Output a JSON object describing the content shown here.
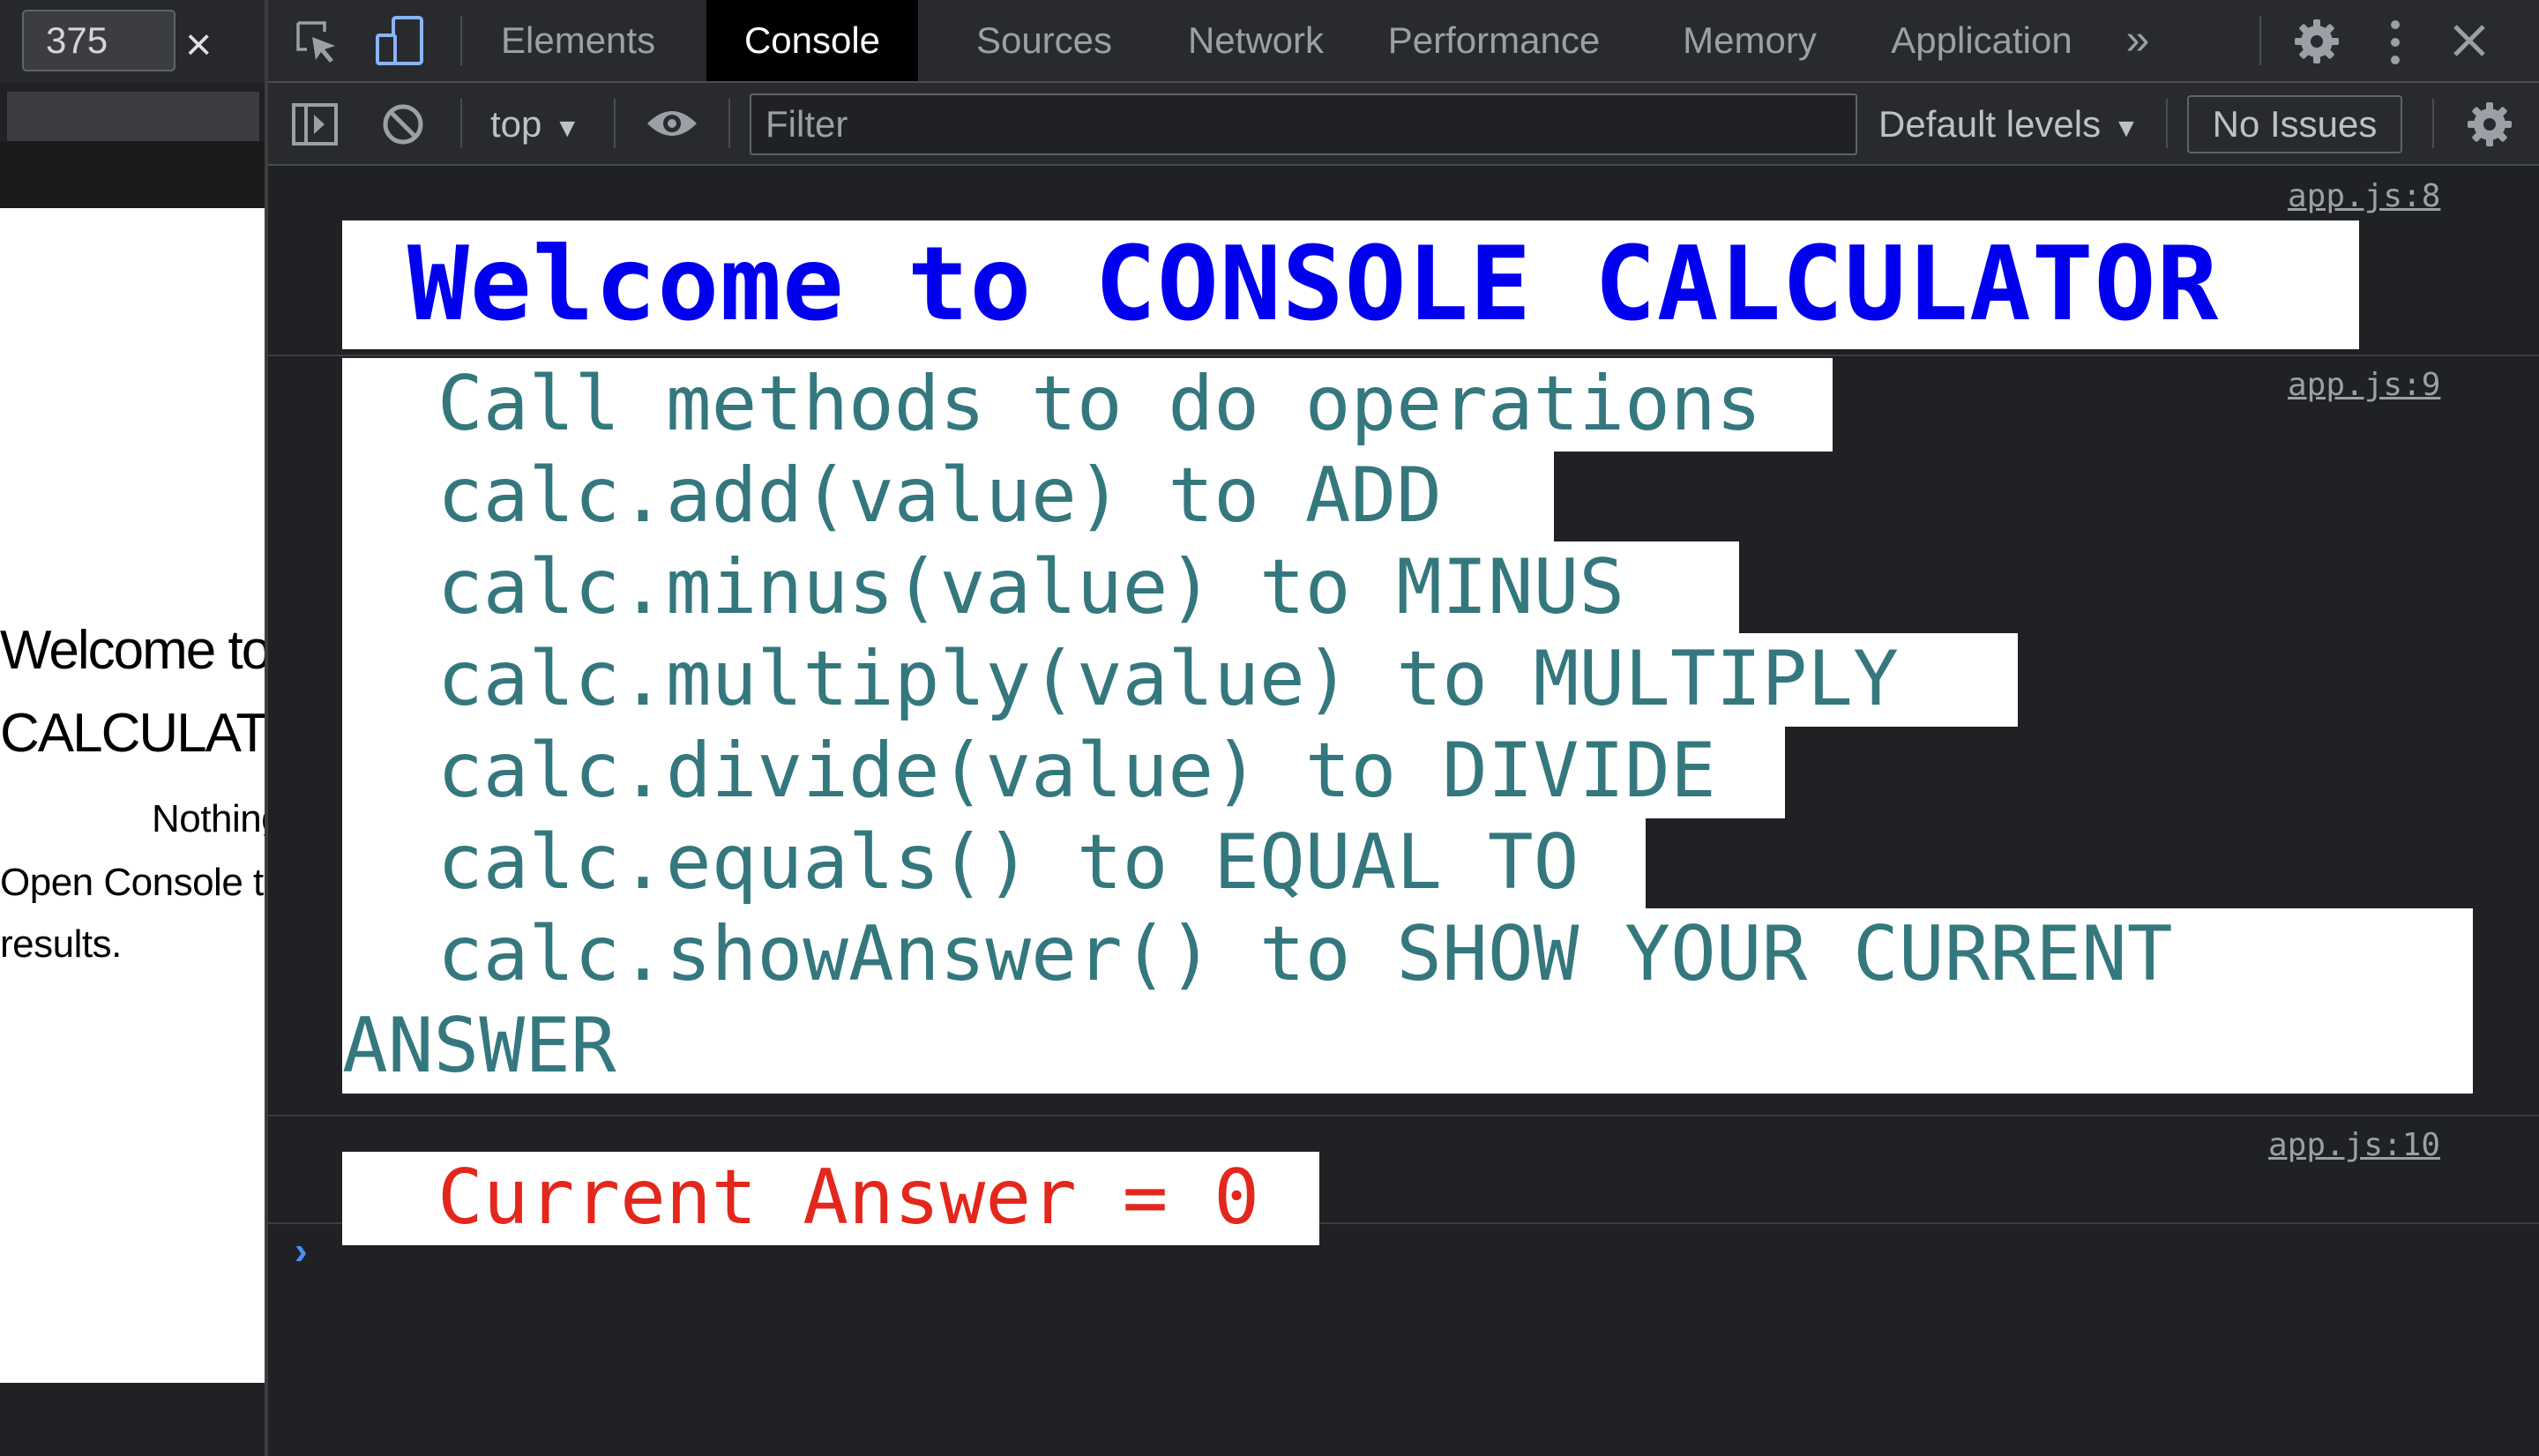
{
  "device_toolbar": {
    "width_value": "375",
    "close_glyph": "×"
  },
  "page_preview": {
    "heading_line1": "Welcome to CONSOLE",
    "heading_line2": "CALCULATOR",
    "paragraph_line1": "Nothing to see here.",
    "paragraph_line2": "Open Console to see",
    "paragraph_line3": "results."
  },
  "devtools": {
    "tabs": [
      "Elements",
      "Console",
      "Sources",
      "Network",
      "Performance",
      "Memory",
      "Application"
    ],
    "active_tab": "Console",
    "more_tabs_glyph": "»",
    "toolbar": {
      "context": "top",
      "filter_placeholder": "Filter",
      "levels": "Default levels",
      "issues": "No Issues"
    }
  },
  "console": {
    "messages": [
      {
        "source": "app.js:8",
        "text": "Welcome to CONSOLE CALCULATOR"
      },
      {
        "source": "app.js:9",
        "lines": [
          "Call methods to do operations",
          "calc.add(value) to ADD",
          "calc.minus(value) to MINUS",
          "calc.multiply(value) to MULTIPLY",
          "calc.divide(value) to DIVIDE",
          "calc.equals() to EQUAL TO",
          "calc.showAnswer() to SHOW YOUR CURRENT",
          "ANSWER"
        ]
      },
      {
        "source": "app.js:10",
        "text": "Current Answer = 0"
      }
    ],
    "prompt_glyph": "›"
  },
  "colors": {
    "devtools_bg": "#202124",
    "toolbar_bg": "#292a2d",
    "welcome_text": "#0000ee",
    "instruction_text": "#34787e",
    "answer_text": "#e3271c",
    "prompt": "#4d8ef7"
  },
  "icons": [
    "inspect-element-icon",
    "device-toggle-icon",
    "settings-gear-icon",
    "kebab-menu-icon",
    "close-icon",
    "sidebar-toggle-icon",
    "clear-console-icon",
    "eye-icon",
    "console-settings-gear-icon"
  ]
}
